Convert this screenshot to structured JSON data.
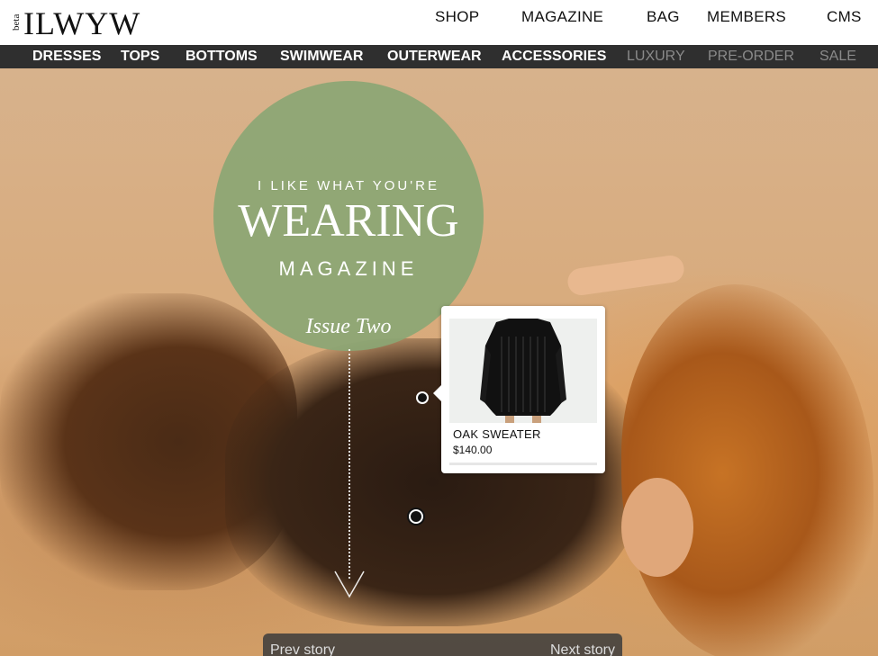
{
  "header": {
    "logo_beta": "beta",
    "logo_text": "ILWYW",
    "nav": [
      "SHOP",
      "MAGAZINE",
      "BAG",
      "MEMBERS",
      "CMS"
    ]
  },
  "categories": {
    "active": [
      "DRESSES",
      "TOPS",
      "BOTTOMS",
      "SWIMWEAR",
      "OUTERWEAR",
      "ACCESSORIES"
    ],
    "dimmed": [
      "LUXURY",
      "PRE-ORDER",
      "SALE"
    ]
  },
  "magazine": {
    "kicker": "I LIKE WHAT YOU'RE",
    "title": "WEARING",
    "subtitle": "MAGAZINE",
    "issue": "Issue Two"
  },
  "product": {
    "name": "OAK SWEATER",
    "price": "$140.00"
  },
  "story_nav": {
    "prev": "Prev story",
    "next": "Next story"
  },
  "colors": {
    "category_bar": "#2f2f2f",
    "magazine_circle": "#8ba674",
    "dim_category": "#8a8a8a"
  }
}
